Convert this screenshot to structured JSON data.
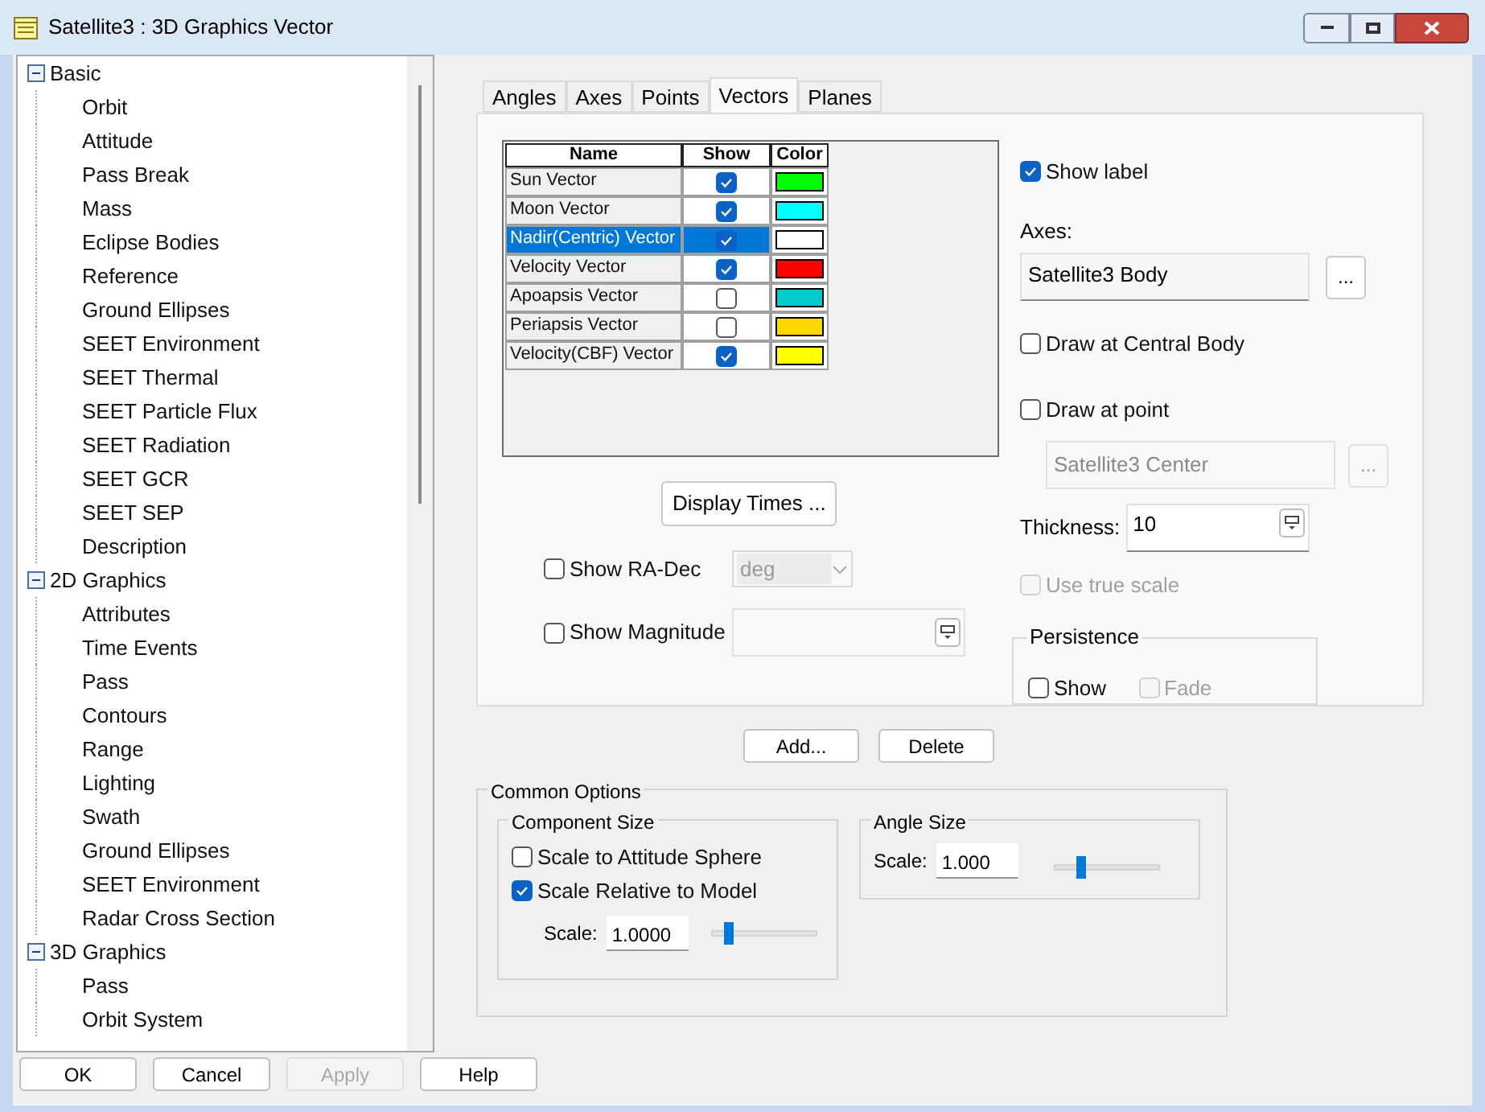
{
  "window": {
    "title": "Satellite3 : 3D Graphics Vector"
  },
  "tree": [
    {
      "label": "Basic",
      "expanded": true,
      "children": [
        {
          "label": "Orbit"
        },
        {
          "label": "Attitude"
        },
        {
          "label": "Pass Break"
        },
        {
          "label": "Mass"
        },
        {
          "label": "Eclipse Bodies"
        },
        {
          "label": "Reference"
        },
        {
          "label": "Ground Ellipses"
        },
        {
          "label": "SEET Environment"
        },
        {
          "label": "SEET Thermal"
        },
        {
          "label": "SEET Particle Flux"
        },
        {
          "label": "SEET Radiation"
        },
        {
          "label": "SEET GCR"
        },
        {
          "label": "SEET SEP"
        },
        {
          "label": "Description"
        }
      ]
    },
    {
      "label": "2D Graphics",
      "expanded": true,
      "children": [
        {
          "label": "Attributes"
        },
        {
          "label": "Time Events"
        },
        {
          "label": "Pass"
        },
        {
          "label": "Contours"
        },
        {
          "label": "Range"
        },
        {
          "label": "Lighting"
        },
        {
          "label": "Swath"
        },
        {
          "label": "Ground Ellipses"
        },
        {
          "label": "SEET Environment"
        },
        {
          "label": "Radar Cross Section"
        }
      ]
    },
    {
      "label": "3D Graphics",
      "expanded": true,
      "children": [
        {
          "label": "Pass"
        },
        {
          "label": "Orbit System"
        }
      ]
    }
  ],
  "tabs": [
    {
      "label": "Angles",
      "selected": false
    },
    {
      "label": "Axes",
      "selected": false
    },
    {
      "label": "Points",
      "selected": false
    },
    {
      "label": "Vectors",
      "selected": true
    },
    {
      "label": "Planes",
      "selected": false
    }
  ],
  "vector_table": {
    "columns": [
      "Name",
      "Show",
      "Color"
    ],
    "rows": [
      {
        "name": "Sun Vector",
        "show": true,
        "color": "#00ff00",
        "selected": false
      },
      {
        "name": "Moon Vector",
        "show": true,
        "color": "#00ffff",
        "selected": false
      },
      {
        "name": "Nadir(Centric) Vector",
        "show": true,
        "color": "#ffffff",
        "selected": true
      },
      {
        "name": "Velocity Vector",
        "show": true,
        "color": "#ff0000",
        "selected": false
      },
      {
        "name": "Apoapsis Vector",
        "show": false,
        "color": "#00cccc",
        "selected": false
      },
      {
        "name": "Periapsis Vector",
        "show": false,
        "color": "#ffd700",
        "selected": false
      },
      {
        "name": "Velocity(CBF) Vector",
        "show": true,
        "color": "#ffff00",
        "selected": false
      }
    ]
  },
  "display_times_button": "Display Times ...",
  "show_ra_dec": {
    "label": "Show RA-Dec",
    "checked": false,
    "unit": "deg"
  },
  "show_magnitude": {
    "label": "Show Magnitude",
    "checked": false
  },
  "show_label": {
    "label": "Show label",
    "checked": true
  },
  "axes": {
    "label": "Axes:",
    "value": "Satellite3 Body",
    "browse": "..."
  },
  "draw_at_central_body": {
    "label": "Draw at Central Body",
    "checked": false
  },
  "draw_at_point": {
    "label": "Draw at point",
    "checked": false,
    "value": "Satellite3 Center",
    "browse": "..."
  },
  "thickness": {
    "label": "Thickness:",
    "value": "10"
  },
  "use_true_scale": {
    "label": "Use true scale",
    "checked": false,
    "disabled": true
  },
  "persistence": {
    "title": "Persistence",
    "show": {
      "label": "Show",
      "checked": false
    },
    "fade": {
      "label": "Fade",
      "checked": false,
      "disabled": true
    }
  },
  "list_buttons": [
    "Add...",
    "Delete"
  ],
  "common_options": {
    "title": "Common Options",
    "component_size": {
      "title": "Component Size",
      "options": [
        {
          "label": "Scale to Attitude Sphere",
          "checked": false
        },
        {
          "label": "Scale Relative to Model",
          "checked": true
        }
      ],
      "scale_label": "Scale:",
      "scale_value": "1.0000",
      "level": 0.13
    },
    "angle_size": {
      "title": "Angle Size",
      "scale_label": "Scale:",
      "scale_value": "1.000",
      "level": 0.22
    }
  },
  "buttons": [
    {
      "label": "OK",
      "disabled": false
    },
    {
      "label": "Cancel",
      "disabled": false
    },
    {
      "label": "Apply",
      "disabled": true
    },
    {
      "label": "Help",
      "disabled": false
    }
  ]
}
